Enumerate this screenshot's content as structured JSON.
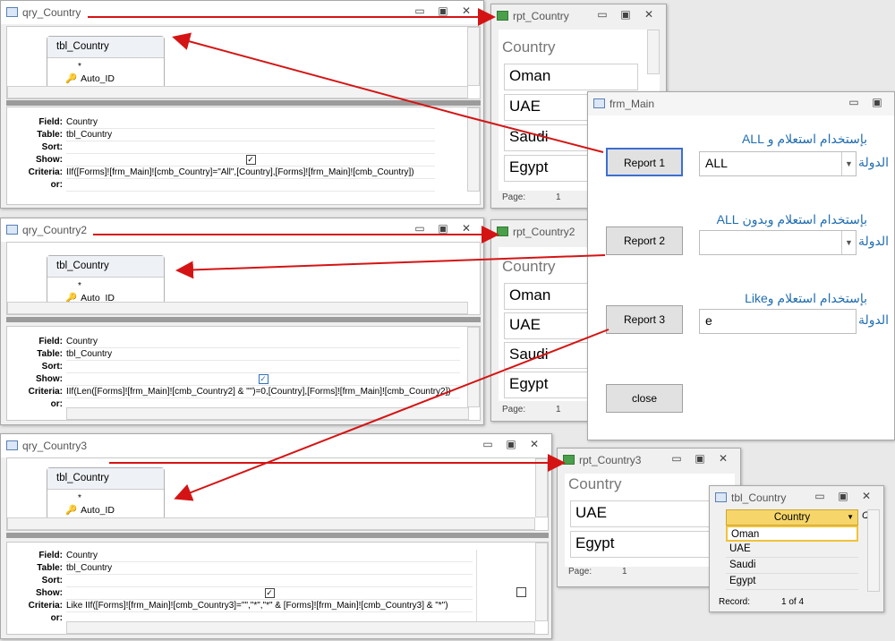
{
  "queries": [
    {
      "title": "qry_Country",
      "table": "tbl_Country",
      "star": "*",
      "key_field": "Auto_ID",
      "labels": [
        "Field:",
        "Table:",
        "Sort:",
        "Show:",
        "Criteria:",
        "or:"
      ],
      "field": "Country",
      "table_row": "tbl_Country",
      "criteria": "IIf([Forms]![frm_Main]![cmb_Country]=\"All\",[Country],[Forms]![frm_Main]![cmb_Country])"
    },
    {
      "title": "qry_Country2",
      "table": "tbl_Country",
      "star": "*",
      "key_field": "Auto_ID",
      "labels": [
        "Field:",
        "Table:",
        "Sort:",
        "Show:",
        "Criteria:",
        "or:"
      ],
      "field": "Country",
      "table_row": "tbl_Country",
      "criteria": "IIf(Len([Forms]![frm_Main]![cmb_Country2] & \"\")=0,[Country],[Forms]![frm_Main]![cmb_Country2])"
    },
    {
      "title": "qry_Country3",
      "table": "tbl_Country",
      "star": "*",
      "key_field": "Auto_ID",
      "labels": [
        "Field:",
        "Table:",
        "Sort:",
        "Show:",
        "Criteria:",
        "or:"
      ],
      "field": "Country",
      "table_row": "tbl_Country",
      "criteria": "Like IIf([Forms]![frm_Main]![cmb_Country3]=\"\",\"*\",\"*\" & [Forms]![frm_Main]![cmb_Country3] & \"*\")"
    }
  ],
  "reports": [
    {
      "title": "rpt_Country",
      "header": "Country",
      "rows": [
        "Oman",
        "UAE",
        "Saudi",
        "Egypt"
      ],
      "page_label": "Page:",
      "page_num": "1"
    },
    {
      "title": "rpt_Country2",
      "header": "Country",
      "rows": [
        "Oman",
        "UAE",
        "Saudi",
        "Egypt"
      ],
      "page_label": "Page:",
      "page_num": "1"
    },
    {
      "title": "rpt_Country3",
      "header": "Country",
      "rows": [
        "UAE",
        "Egypt"
      ],
      "page_label": "Page:",
      "page_num": "1"
    }
  ],
  "form": {
    "title": "frm_Main",
    "sections": [
      {
        "caption": "بإستخدام استعلام و ALL",
        "button": "Report 1",
        "value": "ALL",
        "label": "الدولة"
      },
      {
        "caption": "بإستخدام استعلام وبدون ALL",
        "button": "Report 2",
        "value": "",
        "label": "الدولة"
      },
      {
        "caption": "بإستخدام استعلام وLike",
        "button": "Report 3",
        "value": "e",
        "label": "الدولة"
      }
    ],
    "close_label": "close"
  },
  "datasheet": {
    "title": "tbl_Country",
    "column": "Country",
    "col2": "C",
    "rows": [
      "Oman",
      "UAE",
      "Saudi",
      "Egypt"
    ],
    "record_label": "Record:",
    "record_nav": "1 of 4"
  },
  "icons": {
    "min": "▭",
    "max": "▣",
    "close": "✕"
  }
}
